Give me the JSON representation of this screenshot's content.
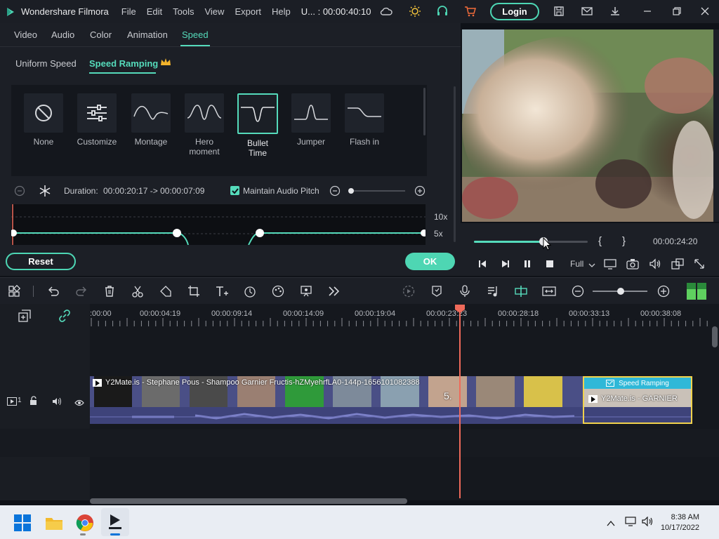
{
  "titlebar": {
    "app_name": "Wondershare Filmora",
    "menus": [
      "File",
      "Edit",
      "Tools",
      "View",
      "Export",
      "Help"
    ],
    "project_time": "U... : 00:00:40:10",
    "login_label": "Login"
  },
  "edit_tabs": [
    "Video",
    "Audio",
    "Color",
    "Animation",
    "Speed"
  ],
  "speed_tabs": [
    "Uniform Speed",
    "Speed Ramping"
  ],
  "presets": [
    {
      "label": "None",
      "icon": "none-icon"
    },
    {
      "label": "Customize",
      "icon": "sliders-icon"
    },
    {
      "label": "Montage",
      "icon": "montage-curve-icon"
    },
    {
      "label": "Hero moment",
      "icon": "hero-curve-icon"
    },
    {
      "label": "Bullet Time",
      "icon": "bullet-curve-icon",
      "selected": true
    },
    {
      "label": "Jumper",
      "icon": "jumper-curve-icon"
    },
    {
      "label": "Flash in",
      "icon": "flash-curve-icon"
    }
  ],
  "duration": {
    "label": "Duration:",
    "value": "00:00:20:17 -> 00:00:07:09",
    "maintain_pitch_label": "Maintain Audio Pitch",
    "maintain_pitch_checked": true
  },
  "curve": {
    "label_top": "10x",
    "label_mid": "5x"
  },
  "buttons": {
    "reset": "Reset",
    "ok": "OK"
  },
  "player": {
    "timecode": "00:00:24:20",
    "progress": 0.61,
    "zoom": "Full",
    "bracket_in": "{",
    "bracket_out": "}"
  },
  "timeline": {
    "ruler": [
      ":00:00",
      "00:00:04:19",
      "00:00:09:14",
      "00:00:14:09",
      "00:00:19:04",
      "00:00:23:23",
      "00:00:28:18",
      "00:00:33:13",
      "00:00:38:08"
    ],
    "clip_title": "Y2Mate.is - Stephane Pous - Shampoo Garnier Fructis-hZMyehrfLA0-144p-1656101082388",
    "ramp_clip_badge": "Speed Ramping",
    "ramp_clip_title": "Y2Mate.is - GARNIER",
    "video_track_label": "1",
    "audio_track_label": "1",
    "frame_overlay": "5."
  },
  "taskbar": {
    "time": "8:38 AM",
    "date": "10/17/2022"
  },
  "colors": {
    "accent": "#55dbbb",
    "playhead": "#ef6a5a",
    "ramp_clip": "#f1d24c"
  }
}
